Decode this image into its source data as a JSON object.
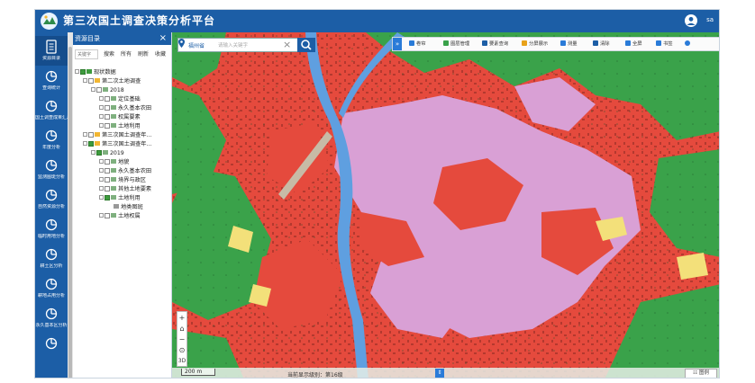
{
  "app": {
    "title": "第三次国土调查决策分析平台",
    "user": "sa"
  },
  "colors": {
    "brand": "#1c5ea6",
    "construction": "#e54a3d",
    "forest": "#3aa24a",
    "cultivated": "#f3e07a",
    "garden": "#d9a0d5",
    "water": "#5f9fe0"
  },
  "rail": [
    {
      "label": "资源目录",
      "icon": "catalog-icon",
      "active": true
    },
    {
      "label": "查询统计",
      "icon": "chart-pie-icon"
    },
    {
      "label": "国土调查成果汇总",
      "icon": "chart-pie-icon"
    },
    {
      "label": "年度分析",
      "icon": "chart-pie-icon"
    },
    {
      "label": "监测图斑分析",
      "icon": "chart-pie-icon"
    },
    {
      "label": "自然资源分析",
      "icon": "chart-pie-icon"
    },
    {
      "label": "临时用地分析",
      "icon": "chart-pie-icon"
    },
    {
      "label": "耕土区分析",
      "icon": "chart-pie-icon"
    },
    {
      "label": "耕地占用分析",
      "icon": "chart-pie-icon"
    },
    {
      "label": "永久基本区分析",
      "icon": "chart-pie-icon"
    },
    {
      "label": "",
      "icon": "chart-pie-icon"
    }
  ],
  "catalog": {
    "title": "资源目录",
    "close": "×",
    "keyword_placeholder": "关键字",
    "buttons": [
      "搜索",
      "所有",
      "刷新",
      "收藏"
    ],
    "tree": [
      {
        "label": "现状数据",
        "level": 0,
        "checked": true,
        "type": "root"
      },
      {
        "label": "第二次土地调查",
        "level": 1,
        "checked": false,
        "type": "folder"
      },
      {
        "label": "2018",
        "level": 2,
        "checked": false,
        "type": "year"
      },
      {
        "label": "定位基础",
        "level": 3,
        "checked": false,
        "type": "layer"
      },
      {
        "label": "永久基本农田",
        "level": 3,
        "checked": false,
        "type": "layer"
      },
      {
        "label": "权属要素",
        "level": 3,
        "checked": false,
        "type": "layer"
      },
      {
        "label": "土地利用",
        "level": 3,
        "checked": false,
        "type": "layer"
      },
      {
        "label": "第三次国土调查年...",
        "level": 1,
        "checked": false,
        "type": "folder"
      },
      {
        "label": "第三次国土调查年...",
        "level": 1,
        "checked": true,
        "type": "folder"
      },
      {
        "label": "2019",
        "level": 2,
        "checked": true,
        "type": "year"
      },
      {
        "label": "地貌",
        "level": 3,
        "checked": false,
        "type": "layer"
      },
      {
        "label": "永久基本农田",
        "level": 3,
        "checked": false,
        "type": "layer"
      },
      {
        "label": "境界与政区",
        "level": 3,
        "checked": false,
        "type": "layer"
      },
      {
        "label": "其他土地要素",
        "level": 3,
        "checked": false,
        "type": "layer"
      },
      {
        "label": "土地利用",
        "level": 3,
        "checked": true,
        "type": "layer"
      },
      {
        "label": "地类图斑",
        "level": 4,
        "checked": false,
        "type": "leaf"
      },
      {
        "label": "土地权属",
        "level": 3,
        "checked": false,
        "type": "layer"
      }
    ]
  },
  "map": {
    "locator": {
      "region": "福州省",
      "placeholder": "请输入关键字",
      "clear": "×"
    },
    "toolbar_toggle": "»",
    "toolbar": [
      {
        "label": "卷帘",
        "icon": "swipe-icon"
      },
      {
        "label": "图层管理",
        "icon": "layers-icon"
      },
      {
        "label": "要素查询",
        "icon": "search-icon"
      },
      {
        "label": "分屏展示",
        "icon": "split-screen-icon"
      },
      {
        "label": "测量",
        "icon": "ruler-icon"
      },
      {
        "label": "清除",
        "icon": "eraser-icon"
      },
      {
        "label": "全屏",
        "icon": "fullscreen-icon"
      },
      {
        "label": "书签",
        "icon": "bookmark-icon"
      },
      {
        "label": "",
        "icon": "info-icon"
      }
    ],
    "zoom": {
      "in": "+",
      "home": "⌂",
      "out": "−",
      "locate": "⊙",
      "mode": "3D"
    },
    "scale": "200 m",
    "status": "当前显示级别：第16级",
    "status_toggle": "⇕",
    "legend_button": "☷ 图例"
  }
}
